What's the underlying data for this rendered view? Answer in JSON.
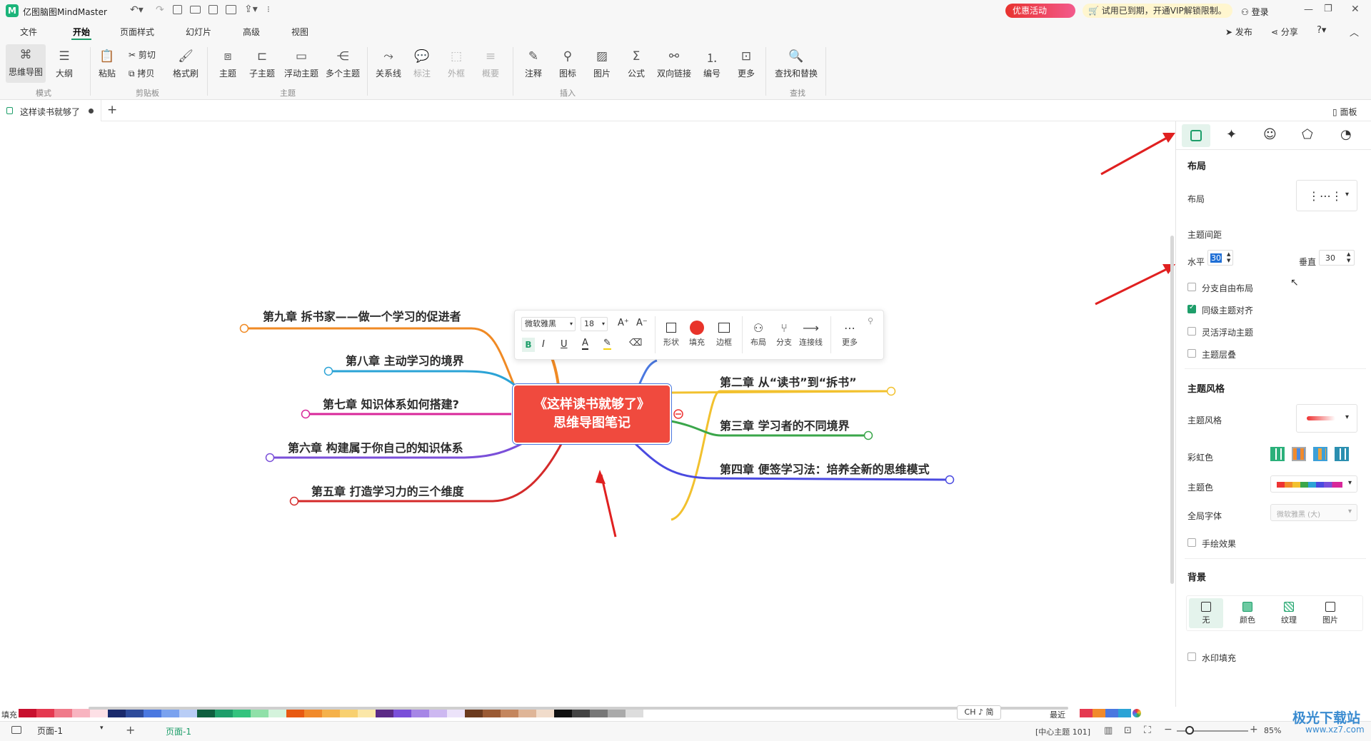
{
  "app": {
    "title": "亿图脑图MindMaster",
    "promo": "优惠活动",
    "vip_notice": "试用已到期，开通VIP解锁限制。",
    "login": "登录",
    "publish": "发布",
    "share": "分享"
  },
  "menu": {
    "items": [
      "文件",
      "开始",
      "页面样式",
      "幻灯片",
      "高级",
      "视图"
    ],
    "active": "开始"
  },
  "ribbon": {
    "mode": {
      "label": "模式",
      "mindmap": "思维导图",
      "outline": "大纲"
    },
    "clipboard": {
      "label": "剪贴板",
      "paste": "粘贴",
      "cut": "剪切",
      "copy": "拷贝",
      "format_brush": "格式刷"
    },
    "topic": {
      "label": "主题",
      "topic": "主题",
      "subtopic": "子主题",
      "floating": "浮动主题",
      "multi": "多个主题"
    },
    "insert": {
      "label": "插入",
      "relation": "关系线",
      "callout": "标注",
      "boundary": "外框",
      "summary": "概要",
      "note": "注释",
      "icon": "图标",
      "image": "图片",
      "formula": "公式",
      "bilink": "双向链接",
      "numbering": "编号",
      "more": "更多"
    },
    "find": {
      "label": "查找",
      "find_replace": "查找和替换"
    }
  },
  "doc_tab": {
    "name": "这样读书就够了",
    "panel_toggle": "面板"
  },
  "mindmap": {
    "central_line1": "《这样读书就够了》",
    "central_line2": "思维导图笔记",
    "right": [
      "第二章 从“读书”到“拆书”",
      "第三章 学习者的不同境界",
      "第四章 便签学习法：培养全新的思维模式"
    ],
    "left": [
      "第九章 拆书家——做一个学习的促进者",
      "第八章 主动学习的境界",
      "第七章 知识体系如何搭建?",
      "第六章 构建属于你自己的知识体系",
      "第五章 打造学习力的三个维度"
    ],
    "colors": {
      "right": [
        "#f2c12e",
        "#3aa64a",
        "#4a4ae0"
      ],
      "left": [
        "#f08a24",
        "#2ba3d6",
        "#d8279a",
        "#7a4fd9",
        "#d42a2a"
      ],
      "central": "#f04a3e"
    }
  },
  "float_toolbar": {
    "font": "微软雅黑",
    "size": "18",
    "shape": "形状",
    "fill": "填充",
    "border": "边框",
    "layout": "布局",
    "branch": "分支",
    "connector": "连接线",
    "more": "更多"
  },
  "panel": {
    "layout_section": "布局",
    "layout_label": "布局",
    "spacing_label": "主题间距",
    "horizontal_label": "水平",
    "horizontal_value": "30",
    "vertical_label": "垂直",
    "vertical_value": "30",
    "checks": [
      {
        "label": "分支自由布局",
        "checked": false
      },
      {
        "label": "同级主题对齐",
        "checked": true
      },
      {
        "label": "灵活浮动主题",
        "checked": false
      },
      {
        "label": "主题层叠",
        "checked": false
      }
    ],
    "style_section": "主题风格",
    "style_label": "主题风格",
    "rainbow_label": "彩虹色",
    "theme_color_label": "主题色",
    "font_label": "全局字体",
    "font_value": "微软雅黑 (大)",
    "hand_drawn": "手绘效果",
    "bg_section": "背景",
    "bg_options": [
      "无",
      "颜色",
      "纹理",
      "图片"
    ],
    "watermark": "水印填充"
  },
  "palette": {
    "label": "填充",
    "recent": "最近"
  },
  "status": {
    "page_select": "页面-1",
    "page_tab": "页面-1",
    "selection": "[中心主题 101]",
    "zoom": "85%",
    "ime": "CH ♪ 简"
  },
  "watermark_brand": "极光下载站",
  "watermark_url": "www.xz7.com"
}
